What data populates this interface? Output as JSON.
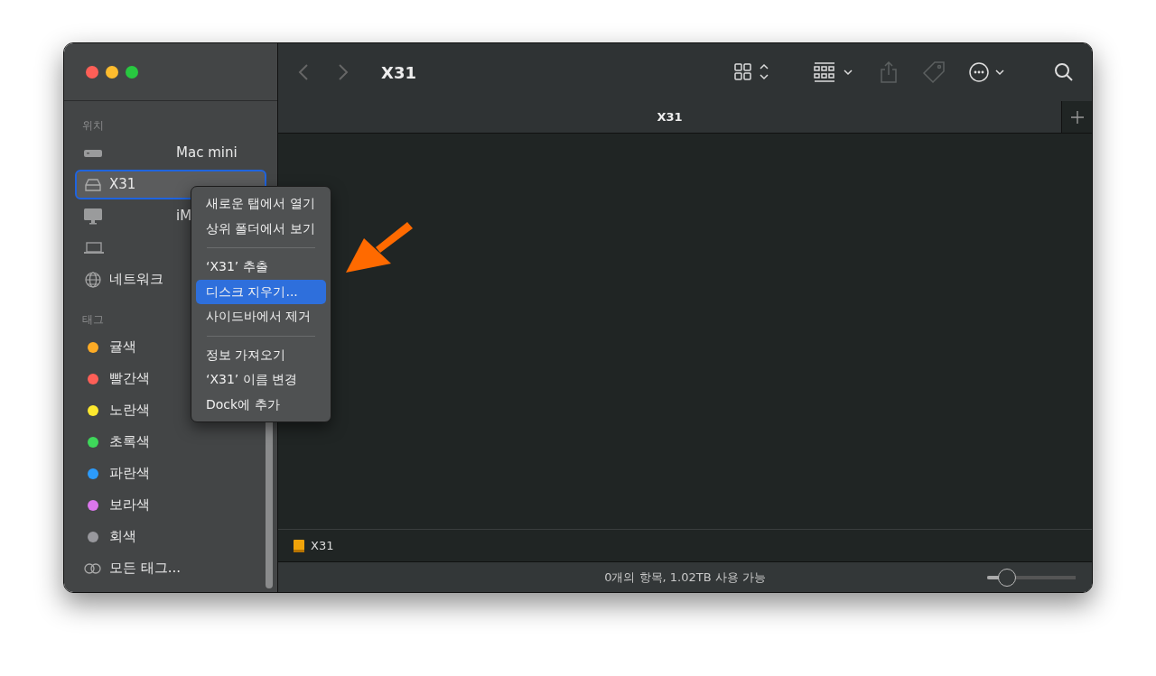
{
  "window": {
    "title": "X31"
  },
  "sidebar": {
    "sections": [
      {
        "title": "위치",
        "items": [
          {
            "kind": "minimac",
            "label": "Mac mini",
            "selected": false
          },
          {
            "kind": "disk",
            "label": "X31",
            "selected": true
          },
          {
            "kind": "desktop",
            "label": "iM",
            "selected": false
          },
          {
            "kind": "laptop",
            "selected": false
          },
          {
            "kind": "network",
            "label": "네트워크",
            "selected": false
          }
        ]
      },
      {
        "title": "태그",
        "items": [
          {
            "kind": "tag",
            "label": "귤색",
            "color": "#fdab25",
            "selected": false
          },
          {
            "kind": "tag",
            "label": "빨간색",
            "color": "#fe5f57",
            "selected": false
          },
          {
            "kind": "tag",
            "label": "노란색",
            "color": "#fde82e",
            "selected": false
          },
          {
            "kind": "tag",
            "label": "초록색",
            "color": "#3ed75a",
            "selected": false
          },
          {
            "kind": "tag",
            "label": "파란색",
            "color": "#2c9bfb",
            "selected": false
          },
          {
            "kind": "tag",
            "label": "보라색",
            "color": "#dc77ed",
            "selected": false
          },
          {
            "kind": "tag",
            "label": "회색",
            "color": "#98989d",
            "selected": false
          },
          {
            "kind": "alltags",
            "label": "모든 태그...",
            "selected": false
          }
        ]
      }
    ]
  },
  "tabs": [
    {
      "label": "X31",
      "selected": true
    }
  ],
  "path_bar": {
    "label": "X31"
  },
  "status_bar": {
    "text": "0개의 항목, 1.02TB 사용 가능",
    "zoom": {
      "level": 0.15
    }
  },
  "context_menu": [
    {
      "kind": "item",
      "label": "새로운 탭에서 열기",
      "selected": false
    },
    {
      "kind": "item",
      "label": "상위 폴더에서 보기",
      "selected": false
    },
    {
      "kind": "separator"
    },
    {
      "kind": "item",
      "label": "‘X31’ 추출",
      "selected": false
    },
    {
      "kind": "item",
      "label": "디스크 지우기...",
      "selected": true
    },
    {
      "kind": "item",
      "label": "사이드바에서 제거",
      "selected": false
    },
    {
      "kind": "separator"
    },
    {
      "kind": "item",
      "label": "정보 가져오기",
      "selected": false
    },
    {
      "kind": "item",
      "label": "‘X31’ 이름 변경",
      "selected": false
    },
    {
      "kind": "item",
      "label": "Dock에 추가",
      "selected": false
    }
  ]
}
